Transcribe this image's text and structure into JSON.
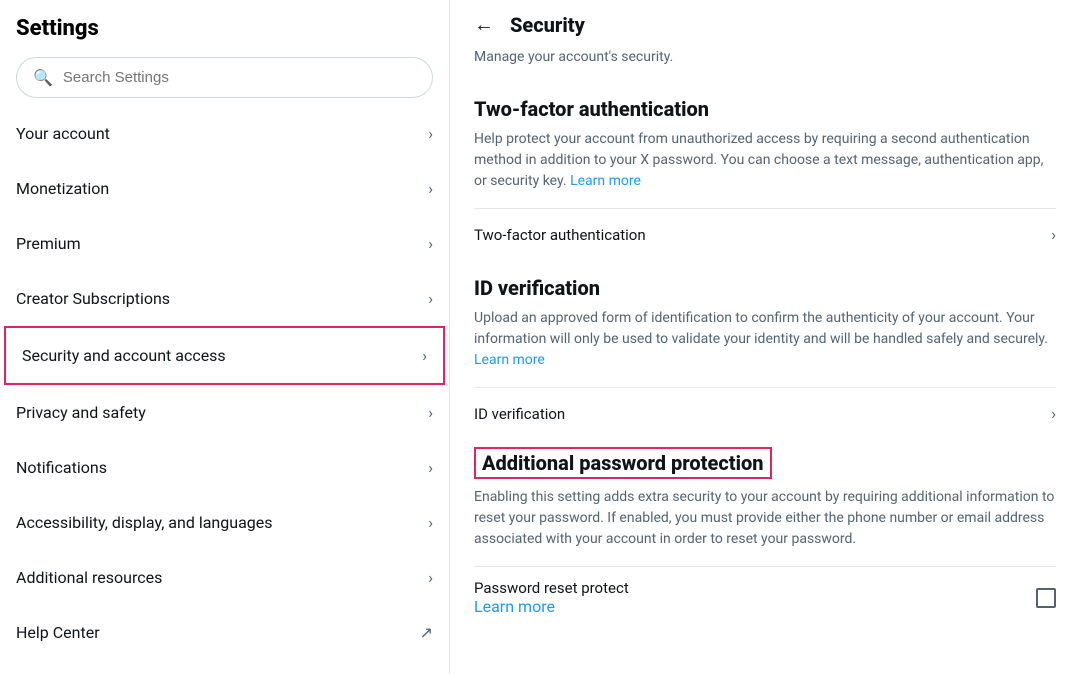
{
  "sidebar": {
    "title": "Settings",
    "search": {
      "placeholder": "Search Settings"
    },
    "nav_items": [
      {
        "id": "your-account",
        "label": "Your account",
        "icon": "chevron-right",
        "external": false,
        "active": false
      },
      {
        "id": "monetization",
        "label": "Monetization",
        "icon": "chevron-right",
        "external": false,
        "active": false
      },
      {
        "id": "premium",
        "label": "Premium",
        "icon": "chevron-right",
        "external": false,
        "active": false
      },
      {
        "id": "creator-subscriptions",
        "label": "Creator Subscriptions",
        "icon": "chevron-right",
        "external": false,
        "active": false
      },
      {
        "id": "security-account-access",
        "label": "Security and account access",
        "icon": "chevron-right",
        "external": false,
        "active": true
      },
      {
        "id": "privacy-safety",
        "label": "Privacy and safety",
        "icon": "chevron-right",
        "external": false,
        "active": false
      },
      {
        "id": "notifications",
        "label": "Notifications",
        "icon": "chevron-right",
        "external": false,
        "active": false
      },
      {
        "id": "accessibility-display-languages",
        "label": "Accessibility, display, and languages",
        "icon": "chevron-right",
        "external": false,
        "active": false
      },
      {
        "id": "additional-resources",
        "label": "Additional resources",
        "icon": "chevron-right",
        "external": false,
        "active": false
      },
      {
        "id": "help-center",
        "label": "Help Center",
        "icon": "external-link",
        "external": true,
        "active": false
      }
    ]
  },
  "content": {
    "back_label": "←",
    "title": "Security",
    "subtitle": "Manage your account's security.",
    "sections": [
      {
        "id": "two-factor-auth",
        "heading": "Two-factor authentication",
        "heading_highlighted": false,
        "description": "Help protect your account from unauthorized access by requiring a second authentication method in addition to your X password. You can choose a text message, authentication app, or security key.",
        "learn_more_text": "Learn more",
        "item_label": "Two-factor authentication",
        "has_checkbox": false
      },
      {
        "id": "id-verification",
        "heading": "ID verification",
        "heading_highlighted": false,
        "description": "Upload an approved form of identification to confirm the authenticity of your account. Your information will only be used to validate your identity and will be handled safely and securely.",
        "learn_more_text": "Learn more",
        "item_label": "ID verification",
        "has_checkbox": false
      },
      {
        "id": "additional-password-protection",
        "heading": "Additional password protection",
        "heading_highlighted": true,
        "description": "Enabling this setting adds extra security to your account by requiring additional information to reset your password. If enabled, you must provide either the phone number or email address associated with your account in order to reset your password.",
        "learn_more_text": "Learn more",
        "item_label": "Password reset protect",
        "has_checkbox": true
      }
    ]
  }
}
